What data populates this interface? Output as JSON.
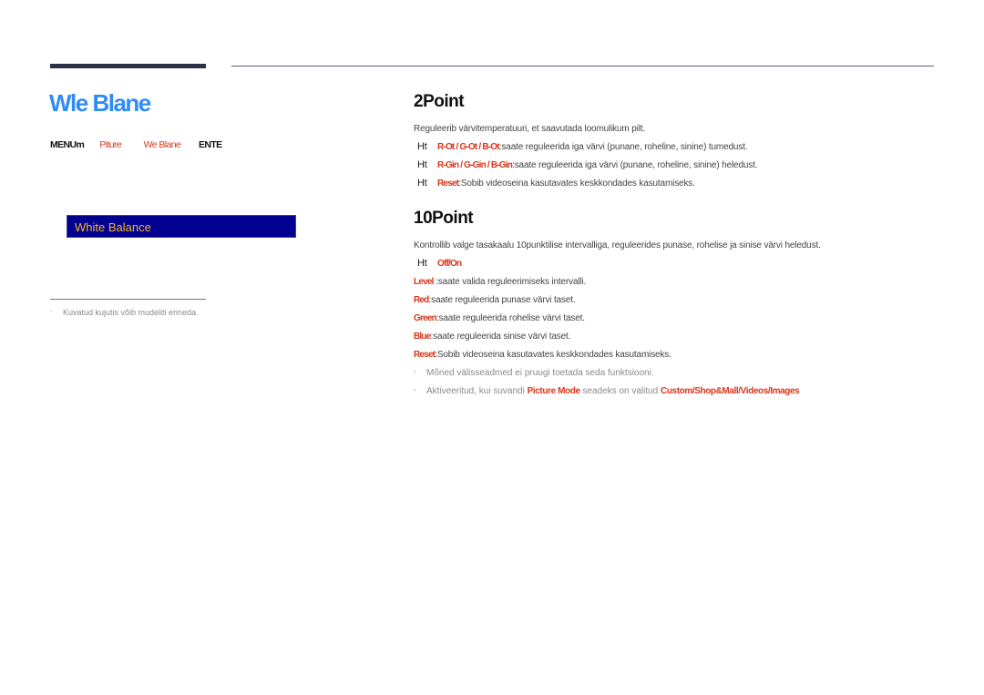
{
  "header": {
    "page_title": "Wle Blane"
  },
  "breadcrumb": {
    "items": [
      {
        "text": "MENUm",
        "style": "black"
      },
      {
        "text": "Piture",
        "style": "red"
      },
      {
        "text": "We Blane",
        "style": "red"
      },
      {
        "text": "ENTE",
        "style": "black"
      }
    ]
  },
  "osd": {
    "label": "White Balance"
  },
  "footnote": {
    "bullet": "-",
    "text": "Kuvatud kujutis võib mudeliti erineda."
  },
  "section_2point": {
    "heading": "2Point",
    "intro": "Reguleerib värvitemperatuuri, et saavutada loomulikum pilt.",
    "items": [
      {
        "marker": "Ht",
        "keys": "R-Ot / G-Ot / B-Ot",
        "text": ":saate reguleerida iga värvi (punane, roheline, sinine) tumedust."
      },
      {
        "marker": "Ht",
        "keys": "R-Gin / G-Gin / B-Gin",
        "text": ":saate reguleerida iga värvi (punane, roheline, sinine) heledust."
      },
      {
        "marker": "Ht",
        "keys": "Reset",
        "text": ":Sobib videoseina kasutavates keskkondades kasutamiseks."
      }
    ]
  },
  "section_10point": {
    "heading": "10Point",
    "intro": "Kontrollib valge tasakaalu 10punktilise intervalliga, reguleerides punase, rohelise ja sinise värvi heledust.",
    "marker_row": {
      "marker": "Ht",
      "keys": "Off/On"
    },
    "items": [
      {
        "keys": "Level",
        "text": "   :saate valida reguleerimiseks intervalli."
      },
      {
        "keys": "Red",
        "text": ":saate reguleerida punase värvi taset."
      },
      {
        "keys": "Green",
        "text": ":saate reguleerida rohelise värvi taset."
      },
      {
        "keys": "Blue",
        "text": ":saate reguleerida sinise värvi taset."
      },
      {
        "keys": "Reset",
        "text": ":Sobib videoseina kasutavates keskkondades kasutamiseks."
      }
    ],
    "notes": [
      {
        "text": "Mõned välisseadmed ei pruugi toetada seda funktsiooni."
      },
      {
        "prefix": "Aktiveeritud, kui suvandi ",
        "key1": "Picture Mode",
        "middle": " seadeks on valitud ",
        "key2": "Custom/Shop&Mall/Videos/Images"
      }
    ]
  },
  "colors": {
    "title_blue": "#2f8cf4",
    "highlight_red": "#d8361a",
    "osd_background": "#02008f",
    "osd_text": "#f1b82b",
    "rule_dark": "#2b3148"
  }
}
